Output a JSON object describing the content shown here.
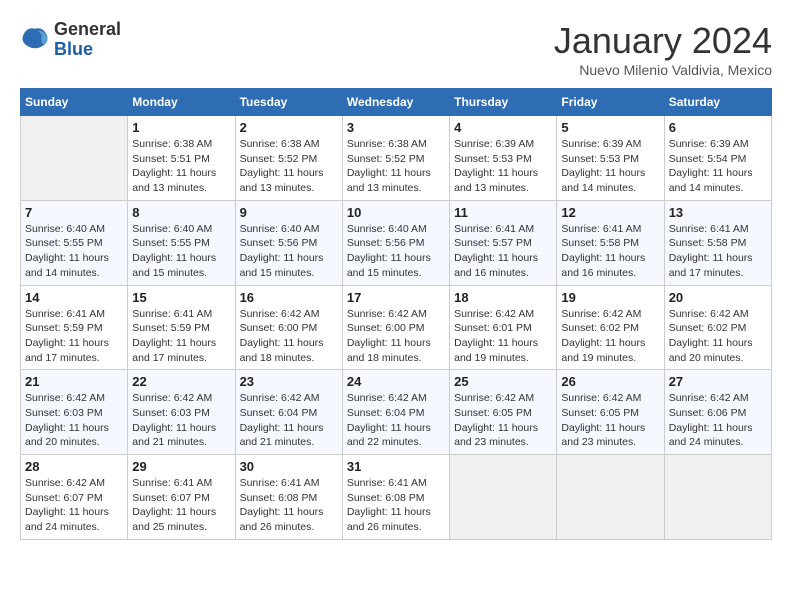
{
  "logo": {
    "general": "General",
    "blue": "Blue"
  },
  "header": {
    "month": "January 2024",
    "location": "Nuevo Milenio Valdivia, Mexico"
  },
  "weekdays": [
    "Sunday",
    "Monday",
    "Tuesday",
    "Wednesday",
    "Thursday",
    "Friday",
    "Saturday"
  ],
  "weeks": [
    [
      {
        "day": "",
        "empty": true
      },
      {
        "day": "1",
        "sunrise": "6:38 AM",
        "sunset": "5:51 PM",
        "daylight": "11 hours and 13 minutes."
      },
      {
        "day": "2",
        "sunrise": "6:38 AM",
        "sunset": "5:52 PM",
        "daylight": "11 hours and 13 minutes."
      },
      {
        "day": "3",
        "sunrise": "6:38 AM",
        "sunset": "5:52 PM",
        "daylight": "11 hours and 13 minutes."
      },
      {
        "day": "4",
        "sunrise": "6:39 AM",
        "sunset": "5:53 PM",
        "daylight": "11 hours and 13 minutes."
      },
      {
        "day": "5",
        "sunrise": "6:39 AM",
        "sunset": "5:53 PM",
        "daylight": "11 hours and 14 minutes."
      },
      {
        "day": "6",
        "sunrise": "6:39 AM",
        "sunset": "5:54 PM",
        "daylight": "11 hours and 14 minutes."
      }
    ],
    [
      {
        "day": "7",
        "sunrise": "6:40 AM",
        "sunset": "5:55 PM",
        "daylight": "11 hours and 14 minutes."
      },
      {
        "day": "8",
        "sunrise": "6:40 AM",
        "sunset": "5:55 PM",
        "daylight": "11 hours and 15 minutes."
      },
      {
        "day": "9",
        "sunrise": "6:40 AM",
        "sunset": "5:56 PM",
        "daylight": "11 hours and 15 minutes."
      },
      {
        "day": "10",
        "sunrise": "6:40 AM",
        "sunset": "5:56 PM",
        "daylight": "11 hours and 15 minutes."
      },
      {
        "day": "11",
        "sunrise": "6:41 AM",
        "sunset": "5:57 PM",
        "daylight": "11 hours and 16 minutes."
      },
      {
        "day": "12",
        "sunrise": "6:41 AM",
        "sunset": "5:58 PM",
        "daylight": "11 hours and 16 minutes."
      },
      {
        "day": "13",
        "sunrise": "6:41 AM",
        "sunset": "5:58 PM",
        "daylight": "11 hours and 17 minutes."
      }
    ],
    [
      {
        "day": "14",
        "sunrise": "6:41 AM",
        "sunset": "5:59 PM",
        "daylight": "11 hours and 17 minutes."
      },
      {
        "day": "15",
        "sunrise": "6:41 AM",
        "sunset": "5:59 PM",
        "daylight": "11 hours and 17 minutes."
      },
      {
        "day": "16",
        "sunrise": "6:42 AM",
        "sunset": "6:00 PM",
        "daylight": "11 hours and 18 minutes."
      },
      {
        "day": "17",
        "sunrise": "6:42 AM",
        "sunset": "6:00 PM",
        "daylight": "11 hours and 18 minutes."
      },
      {
        "day": "18",
        "sunrise": "6:42 AM",
        "sunset": "6:01 PM",
        "daylight": "11 hours and 19 minutes."
      },
      {
        "day": "19",
        "sunrise": "6:42 AM",
        "sunset": "6:02 PM",
        "daylight": "11 hours and 19 minutes."
      },
      {
        "day": "20",
        "sunrise": "6:42 AM",
        "sunset": "6:02 PM",
        "daylight": "11 hours and 20 minutes."
      }
    ],
    [
      {
        "day": "21",
        "sunrise": "6:42 AM",
        "sunset": "6:03 PM",
        "daylight": "11 hours and 20 minutes."
      },
      {
        "day": "22",
        "sunrise": "6:42 AM",
        "sunset": "6:03 PM",
        "daylight": "11 hours and 21 minutes."
      },
      {
        "day": "23",
        "sunrise": "6:42 AM",
        "sunset": "6:04 PM",
        "daylight": "11 hours and 21 minutes."
      },
      {
        "day": "24",
        "sunrise": "6:42 AM",
        "sunset": "6:04 PM",
        "daylight": "11 hours and 22 minutes."
      },
      {
        "day": "25",
        "sunrise": "6:42 AM",
        "sunset": "6:05 PM",
        "daylight": "11 hours and 23 minutes."
      },
      {
        "day": "26",
        "sunrise": "6:42 AM",
        "sunset": "6:05 PM",
        "daylight": "11 hours and 23 minutes."
      },
      {
        "day": "27",
        "sunrise": "6:42 AM",
        "sunset": "6:06 PM",
        "daylight": "11 hours and 24 minutes."
      }
    ],
    [
      {
        "day": "28",
        "sunrise": "6:42 AM",
        "sunset": "6:07 PM",
        "daylight": "11 hours and 24 minutes."
      },
      {
        "day": "29",
        "sunrise": "6:41 AM",
        "sunset": "6:07 PM",
        "daylight": "11 hours and 25 minutes."
      },
      {
        "day": "30",
        "sunrise": "6:41 AM",
        "sunset": "6:08 PM",
        "daylight": "11 hours and 26 minutes."
      },
      {
        "day": "31",
        "sunrise": "6:41 AM",
        "sunset": "6:08 PM",
        "daylight": "11 hours and 26 minutes."
      },
      {
        "day": "",
        "empty": true
      },
      {
        "day": "",
        "empty": true
      },
      {
        "day": "",
        "empty": true
      }
    ]
  ]
}
